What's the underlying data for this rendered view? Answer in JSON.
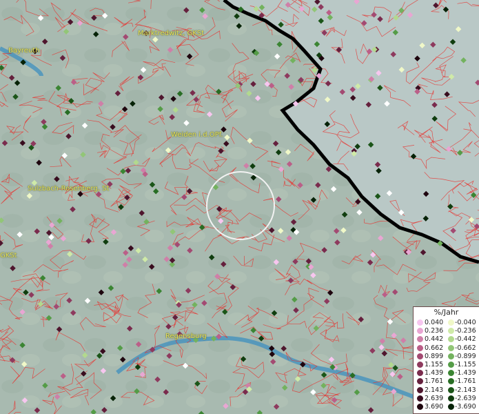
{
  "map": {
    "labels": {
      "marktredwitz": "Marktredwitz, GKSt",
      "bayreuth": "Bayreuth",
      "weiden": "Weiden i.d.OPf.",
      "sulzbach": "Sulzbach-Rosenberg, St",
      "gkst": "GKSt",
      "regensburg": "Regensburg"
    },
    "colors": {
      "land": "#a9bbb0",
      "outside_country": "#b7c8c6",
      "border": "#000000",
      "district_lines": "#e8302c",
      "river": "#3e8fbf",
      "label_text": "#e8e25a",
      "highlight_circle": "#f2f2f2"
    }
  },
  "legend": {
    "title": "%/Jahr",
    "positive": [
      {
        "label": "0.040",
        "color": "#f7c6ef"
      },
      {
        "label": "0.236",
        "color": "#e9a6d3"
      },
      {
        "label": "0.442",
        "color": "#cf7fa8"
      },
      {
        "label": "0.662",
        "color": "#bb5f88"
      },
      {
        "label": "0.899",
        "color": "#a34a72"
      },
      {
        "label": "1.155",
        "color": "#8e3a5e"
      },
      {
        "label": "1.439",
        "color": "#7a2b4d"
      },
      {
        "label": "1.761",
        "color": "#65203d"
      },
      {
        "label": "2.143",
        "color": "#4f162e"
      },
      {
        "label": "2.639",
        "color": "#380c1e"
      },
      {
        "label": "3.690",
        "color": "#1e050e"
      }
    ],
    "negative": [
      {
        "label": "-0.040",
        "color": "#f0f8c8"
      },
      {
        "label": "-0.236",
        "color": "#cfeaa8"
      },
      {
        "label": "-0.442",
        "color": "#b2d98e"
      },
      {
        "label": "-0.662",
        "color": "#92c677"
      },
      {
        "label": "-0.899",
        "color": "#73b25e"
      },
      {
        "label": "-1.155",
        "color": "#549c47"
      },
      {
        "label": "-1.439",
        "color": "#3b8533"
      },
      {
        "label": "-1.761",
        "color": "#286d24"
      },
      {
        "label": "-2.143",
        "color": "#1b5518"
      },
      {
        "label": "-2.639",
        "color": "#103d0f"
      },
      {
        "label": "-3.690",
        "color": "#062207"
      }
    ]
  }
}
